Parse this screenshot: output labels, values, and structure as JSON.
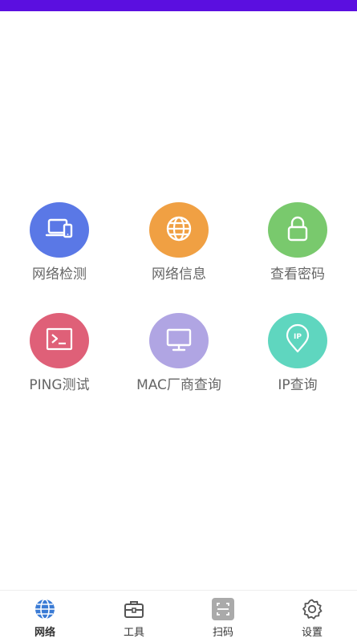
{
  "grid": {
    "tiles": [
      {
        "label": "网络检测",
        "color": "#5a78e6",
        "icon": "devices-icon"
      },
      {
        "label": "网络信息",
        "color": "#f0a043",
        "icon": "globe-icon"
      },
      {
        "label": "查看密码",
        "color": "#79c96d",
        "icon": "lock-icon"
      },
      {
        "label": "PING测试",
        "color": "#df6078",
        "icon": "terminal-icon"
      },
      {
        "label": "MAC厂商查询",
        "color": "#b0a5e3",
        "icon": "monitor-icon"
      },
      {
        "label": "IP查询",
        "color": "#5fd6bf",
        "icon": "ip-location-icon"
      }
    ]
  },
  "tabbar": {
    "tabs": [
      {
        "label": "网络",
        "icon": "globe-icon",
        "active": true,
        "color": "#3a7bd5"
      },
      {
        "label": "工具",
        "icon": "toolbox-icon",
        "active": false,
        "color": "#555555"
      },
      {
        "label": "扫码",
        "icon": "scan-icon",
        "active": false,
        "color": "#999999"
      },
      {
        "label": "设置",
        "icon": "gear-icon",
        "active": false,
        "color": "#555555"
      }
    ]
  },
  "colors": {
    "statusbar": "#5b0fe0"
  }
}
